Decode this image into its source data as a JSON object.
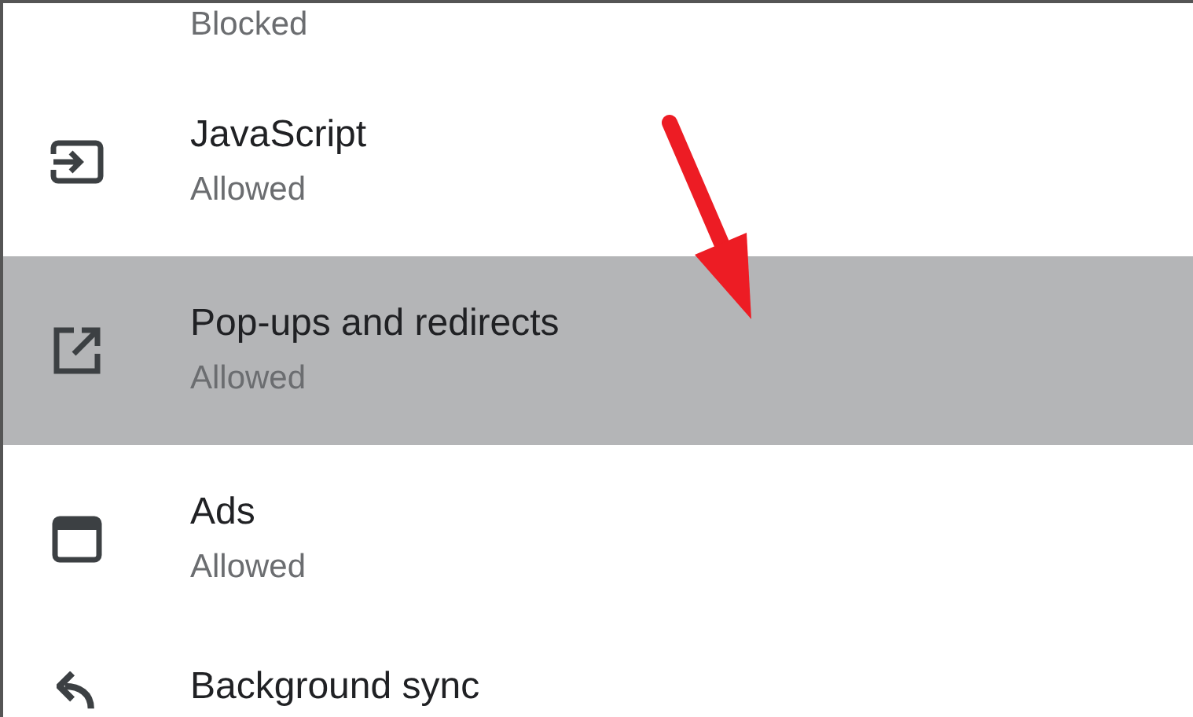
{
  "settings_items": [
    {
      "kind": "sound",
      "subtitle": "Blocked",
      "selected": false
    },
    {
      "kind": "javascript",
      "title": "JavaScript",
      "subtitle": "Allowed",
      "selected": false
    },
    {
      "kind": "popups",
      "title": "Pop-ups and redirects",
      "subtitle": "Allowed",
      "selected": true
    },
    {
      "kind": "ads",
      "title": "Ads",
      "subtitle": "Allowed",
      "selected": false
    },
    {
      "kind": "sync",
      "title": "Background sync",
      "selected": false
    }
  ]
}
